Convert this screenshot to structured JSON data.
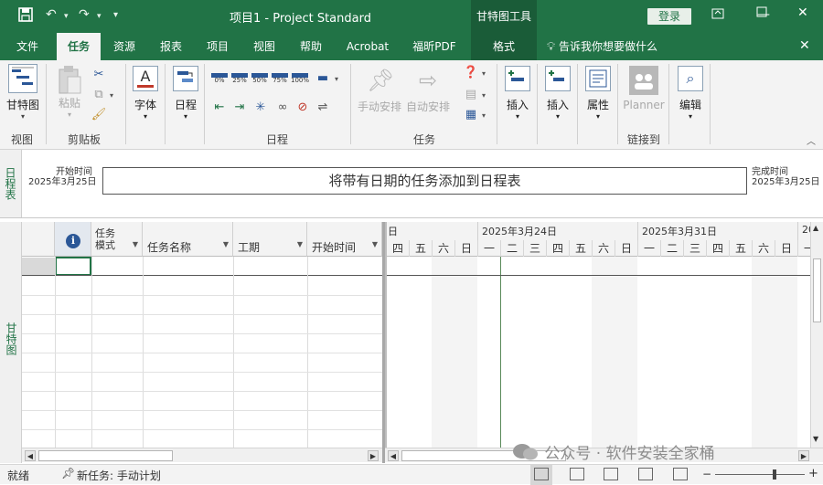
{
  "titlebar": {
    "title": "项目1  -  Project Standard",
    "context_tab_title": "甘特图工具",
    "login_label": "登录"
  },
  "tabs": [
    {
      "label": "文件",
      "active": false
    },
    {
      "label": "任务",
      "active": true
    },
    {
      "label": "资源",
      "active": false
    },
    {
      "label": "报表",
      "active": false
    },
    {
      "label": "项目",
      "active": false
    },
    {
      "label": "视图",
      "active": false
    },
    {
      "label": "帮助",
      "active": false
    },
    {
      "label": "Acrobat",
      "active": false
    },
    {
      "label": "福昕PDF",
      "active": false
    },
    {
      "label": "格式",
      "active": false
    }
  ],
  "tell_me": "告诉我你想要做什么",
  "ribbon": {
    "gantt_label": "甘特图",
    "paste_label": "粘贴",
    "font_label": "字体",
    "schedule_label": "日程",
    "pct_labels": [
      "0%",
      "25%",
      "50%",
      "75%",
      "100%"
    ],
    "manual_label": "手动安排",
    "auto_label": "自动安排",
    "insert1_label": "插入",
    "insert2_label": "插入",
    "properties_label": "属性",
    "planner_label": "Planner",
    "edit_label": "编辑",
    "groups": {
      "view": "视图",
      "clipboard": "剪贴板",
      "schedule": "日程",
      "tasks": "任务",
      "link": "链接到"
    }
  },
  "timeline": {
    "side_label": "日程表",
    "start_title": "开始时间",
    "start_date": "2025年3月25日",
    "finish_title": "完成时间",
    "finish_date": "2025年3月25日",
    "placeholder": "将带有日期的任务添加到日程表"
  },
  "grid": {
    "side_label": "甘特图",
    "columns": [
      {
        "label": "i"
      },
      {
        "label": "任务\n模式"
      },
      {
        "label": "任务名称"
      },
      {
        "label": "工期"
      },
      {
        "label": "开始时间"
      }
    ]
  },
  "chart": {
    "prev_week_fragment": "日",
    "weeks": [
      "2025年3月24日",
      "2025年3月31日",
      "20"
    ],
    "days": [
      "四",
      "五",
      "六",
      "日",
      "一",
      "二",
      "三",
      "四",
      "五",
      "六",
      "日",
      "一",
      "二",
      "三",
      "四",
      "五",
      "六",
      "日",
      "一"
    ]
  },
  "statusbar": {
    "ready": "就绪",
    "new_tasks": "新任务: 手动计划"
  },
  "watermark": "公众号 · 软件安装全家桶"
}
